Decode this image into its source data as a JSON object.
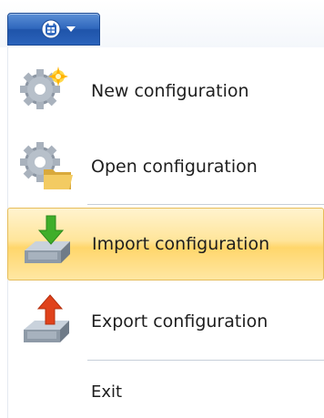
{
  "app_menu": {
    "button_icon": "app-logo-icon",
    "button_arrow": "chevron-down-icon"
  },
  "menu": {
    "items": [
      {
        "label": "New configuration",
        "icon": "gear-new-icon",
        "highlighted": false
      },
      {
        "label": "Open configuration",
        "icon": "gear-folder-icon",
        "highlighted": false
      },
      {
        "label": "Import configuration",
        "icon": "import-tray-icon",
        "highlighted": true
      },
      {
        "label": "Export configuration",
        "icon": "export-tray-icon",
        "highlighted": false
      },
      {
        "label": "Exit",
        "icon": "",
        "highlighted": false
      }
    ]
  },
  "colors": {
    "highlight": "#ffe59a",
    "app_button": "#2f67bd",
    "import_arrow": "#3fae2a",
    "export_arrow": "#e0421b"
  }
}
